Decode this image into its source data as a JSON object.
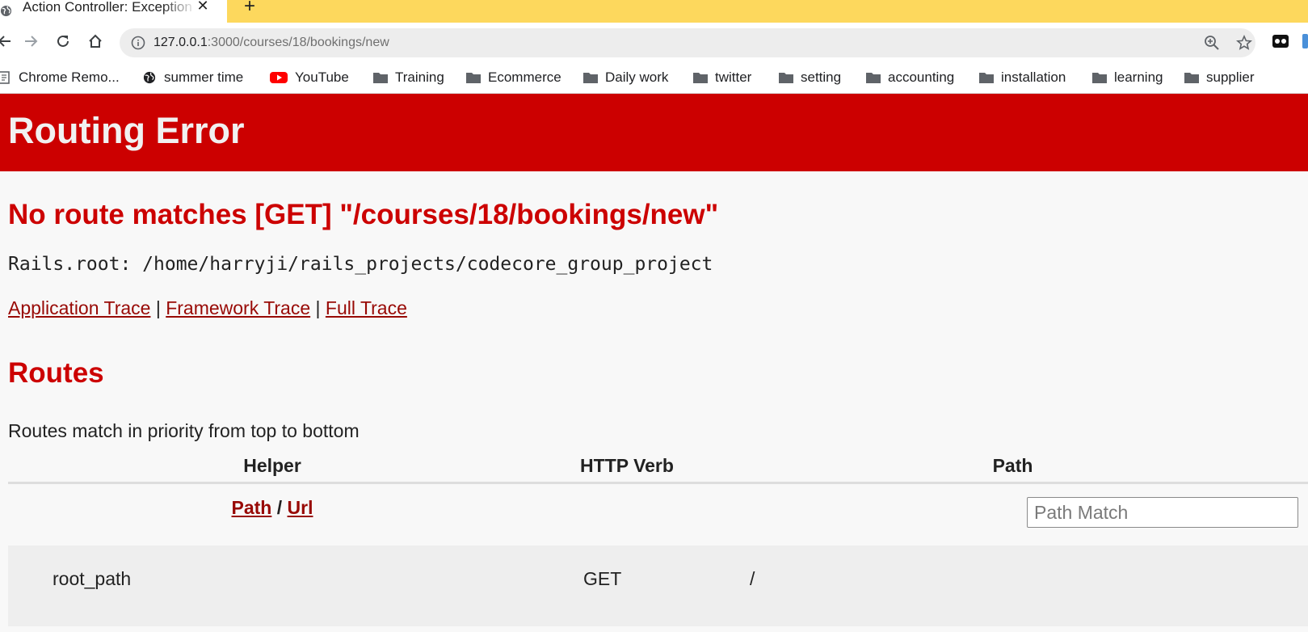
{
  "browser": {
    "tab_title": "Action Controller: Exception caught",
    "tab_close": "✕",
    "new_tab": "+",
    "url_host": "127.0.0.1",
    "url_rest": ":3000/courses/18/bookings/new"
  },
  "bookmarks": [
    {
      "label": "Chrome Remo...",
      "icon": "page-icon"
    },
    {
      "label": "summer time",
      "icon": "globe-icon"
    },
    {
      "label": "YouTube",
      "icon": "youtube-icon"
    },
    {
      "label": "Training",
      "icon": "folder-icon"
    },
    {
      "label": "Ecommerce",
      "icon": "folder-icon"
    },
    {
      "label": "Daily work",
      "icon": "folder-icon"
    },
    {
      "label": "twitter",
      "icon": "folder-icon"
    },
    {
      "label": "setting",
      "icon": "folder-icon"
    },
    {
      "label": "accounting",
      "icon": "folder-icon"
    },
    {
      "label": "installation",
      "icon": "folder-icon"
    },
    {
      "label": "learning",
      "icon": "folder-icon"
    },
    {
      "label": "supplier",
      "icon": "folder-icon"
    }
  ],
  "page": {
    "header_title": "Routing Error",
    "error_message": "No route matches [GET] \"/courses/18/bookings/new\"",
    "rails_root": "Rails.root: /home/harryji/rails_projects/codecore_group_project",
    "traces": {
      "application": "Application Trace",
      "framework": "Framework Trace",
      "full": "Full Trace",
      "separator": "|"
    },
    "routes_heading": "Routes",
    "routes_description": "Routes match in priority from top to bottom",
    "table": {
      "headers": {
        "helper": "Helper",
        "verb": "HTTP Verb",
        "path": "Path"
      },
      "filter": {
        "path_link": "Path",
        "separator": "/",
        "url_link": "Url",
        "path_match_placeholder": "Path Match"
      },
      "rows": [
        {
          "helper": "root_path",
          "verb": "GET",
          "path": "/"
        }
      ]
    }
  },
  "colors": {
    "header_bg": "#cc0000",
    "accent_red": "#cc0000",
    "link": "#980905",
    "tabstrip": "#fdd85d"
  }
}
